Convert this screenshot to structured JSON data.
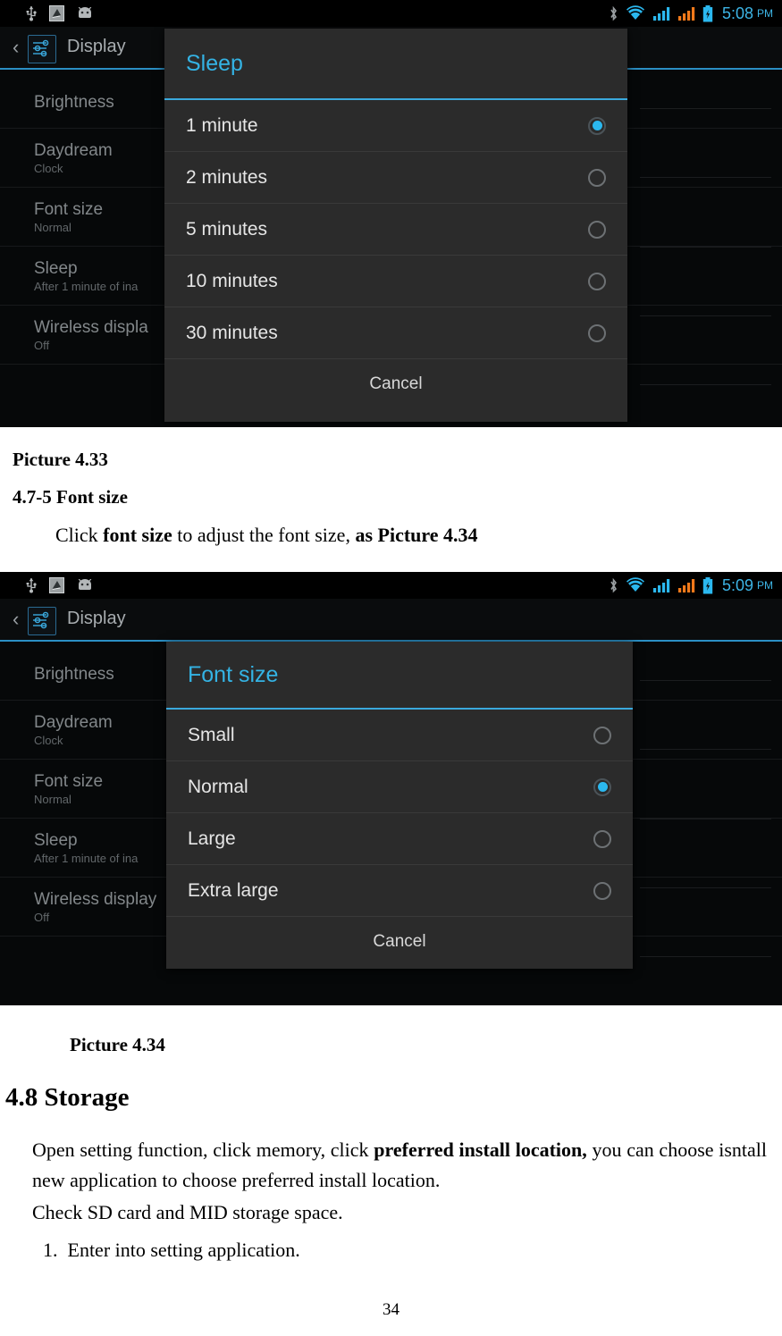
{
  "page": {
    "number": "34"
  },
  "screenshot1": {
    "statusbar": {
      "icons": [
        "usb-icon",
        "screenshot-icon",
        "android-robot-icon"
      ],
      "right_icons": [
        "bluetooth-icon",
        "wifi-icon",
        "signal-sim1-icon",
        "signal-sim2-icon",
        "battery-charging-icon"
      ],
      "time": "5:08",
      "ampm": "PM"
    },
    "actionbar": {
      "back_glyph": "‹",
      "icon": "settings-sliders-icon",
      "title": "Display"
    },
    "settings": [
      {
        "title": "Brightness",
        "summary": ""
      },
      {
        "title": "Daydream",
        "summary": "Clock"
      },
      {
        "title": "Font size",
        "summary": "Normal"
      },
      {
        "title": "Sleep",
        "summary": "After 1 minute of ina"
      },
      {
        "title": "Wireless displa",
        "summary": "Off"
      }
    ],
    "dialog": {
      "title": "Sleep",
      "options": [
        {
          "label": "1 minute",
          "selected": true
        },
        {
          "label": "2 minutes",
          "selected": false
        },
        {
          "label": "5 minutes",
          "selected": false
        },
        {
          "label": "10 minutes",
          "selected": false
        },
        {
          "label": "30 minutes",
          "selected": false
        }
      ],
      "cancel": "Cancel"
    }
  },
  "screenshot2": {
    "statusbar": {
      "time": "5:09",
      "ampm": "PM"
    },
    "actionbar": {
      "back_glyph": "‹",
      "icon": "settings-sliders-icon",
      "title": "Display"
    },
    "settings": [
      {
        "title": "Brightness",
        "summary": ""
      },
      {
        "title": "Daydream",
        "summary": "Clock"
      },
      {
        "title": "Font size",
        "summary": "Normal"
      },
      {
        "title": "Sleep",
        "summary": "After 1 minute of ina"
      },
      {
        "title": "Wireless display",
        "summary": "Off"
      }
    ],
    "dialog": {
      "title": "Font size",
      "options": [
        {
          "label": "Small",
          "selected": false
        },
        {
          "label": "Normal",
          "selected": true
        },
        {
          "label": "Large",
          "selected": false
        },
        {
          "label": "Extra large",
          "selected": false
        }
      ],
      "cancel": "Cancel"
    }
  },
  "doc": {
    "caption_433": "Picture 4.33",
    "heading_475": "4.7-5 Font size",
    "para_click_prefix": "Click ",
    "para_click_bold1": "font size",
    "para_click_mid": " to adjust the font size, ",
    "para_click_bold2": "as Picture 4.34",
    "caption_434": "Picture 4.34",
    "heading_48": "4.8 Storage",
    "para_storage_a": "Open setting function, click memory, click ",
    "para_storage_bold": "preferred install location,",
    "para_storage_b": " you can choose isntall new application to choose preferred install location.",
    "para_check": "Check SD card and MID storage space.",
    "list_item_1_num": "1.",
    "list_item_1_text": "Enter into setting application."
  },
  "colors": {
    "accent_blue": "#3aa9dd",
    "title_blue": "#34b3e4",
    "radio_on": "#2bb8ef",
    "dialog_bg": "#2b2b2b",
    "screen_bg": "#060809"
  }
}
